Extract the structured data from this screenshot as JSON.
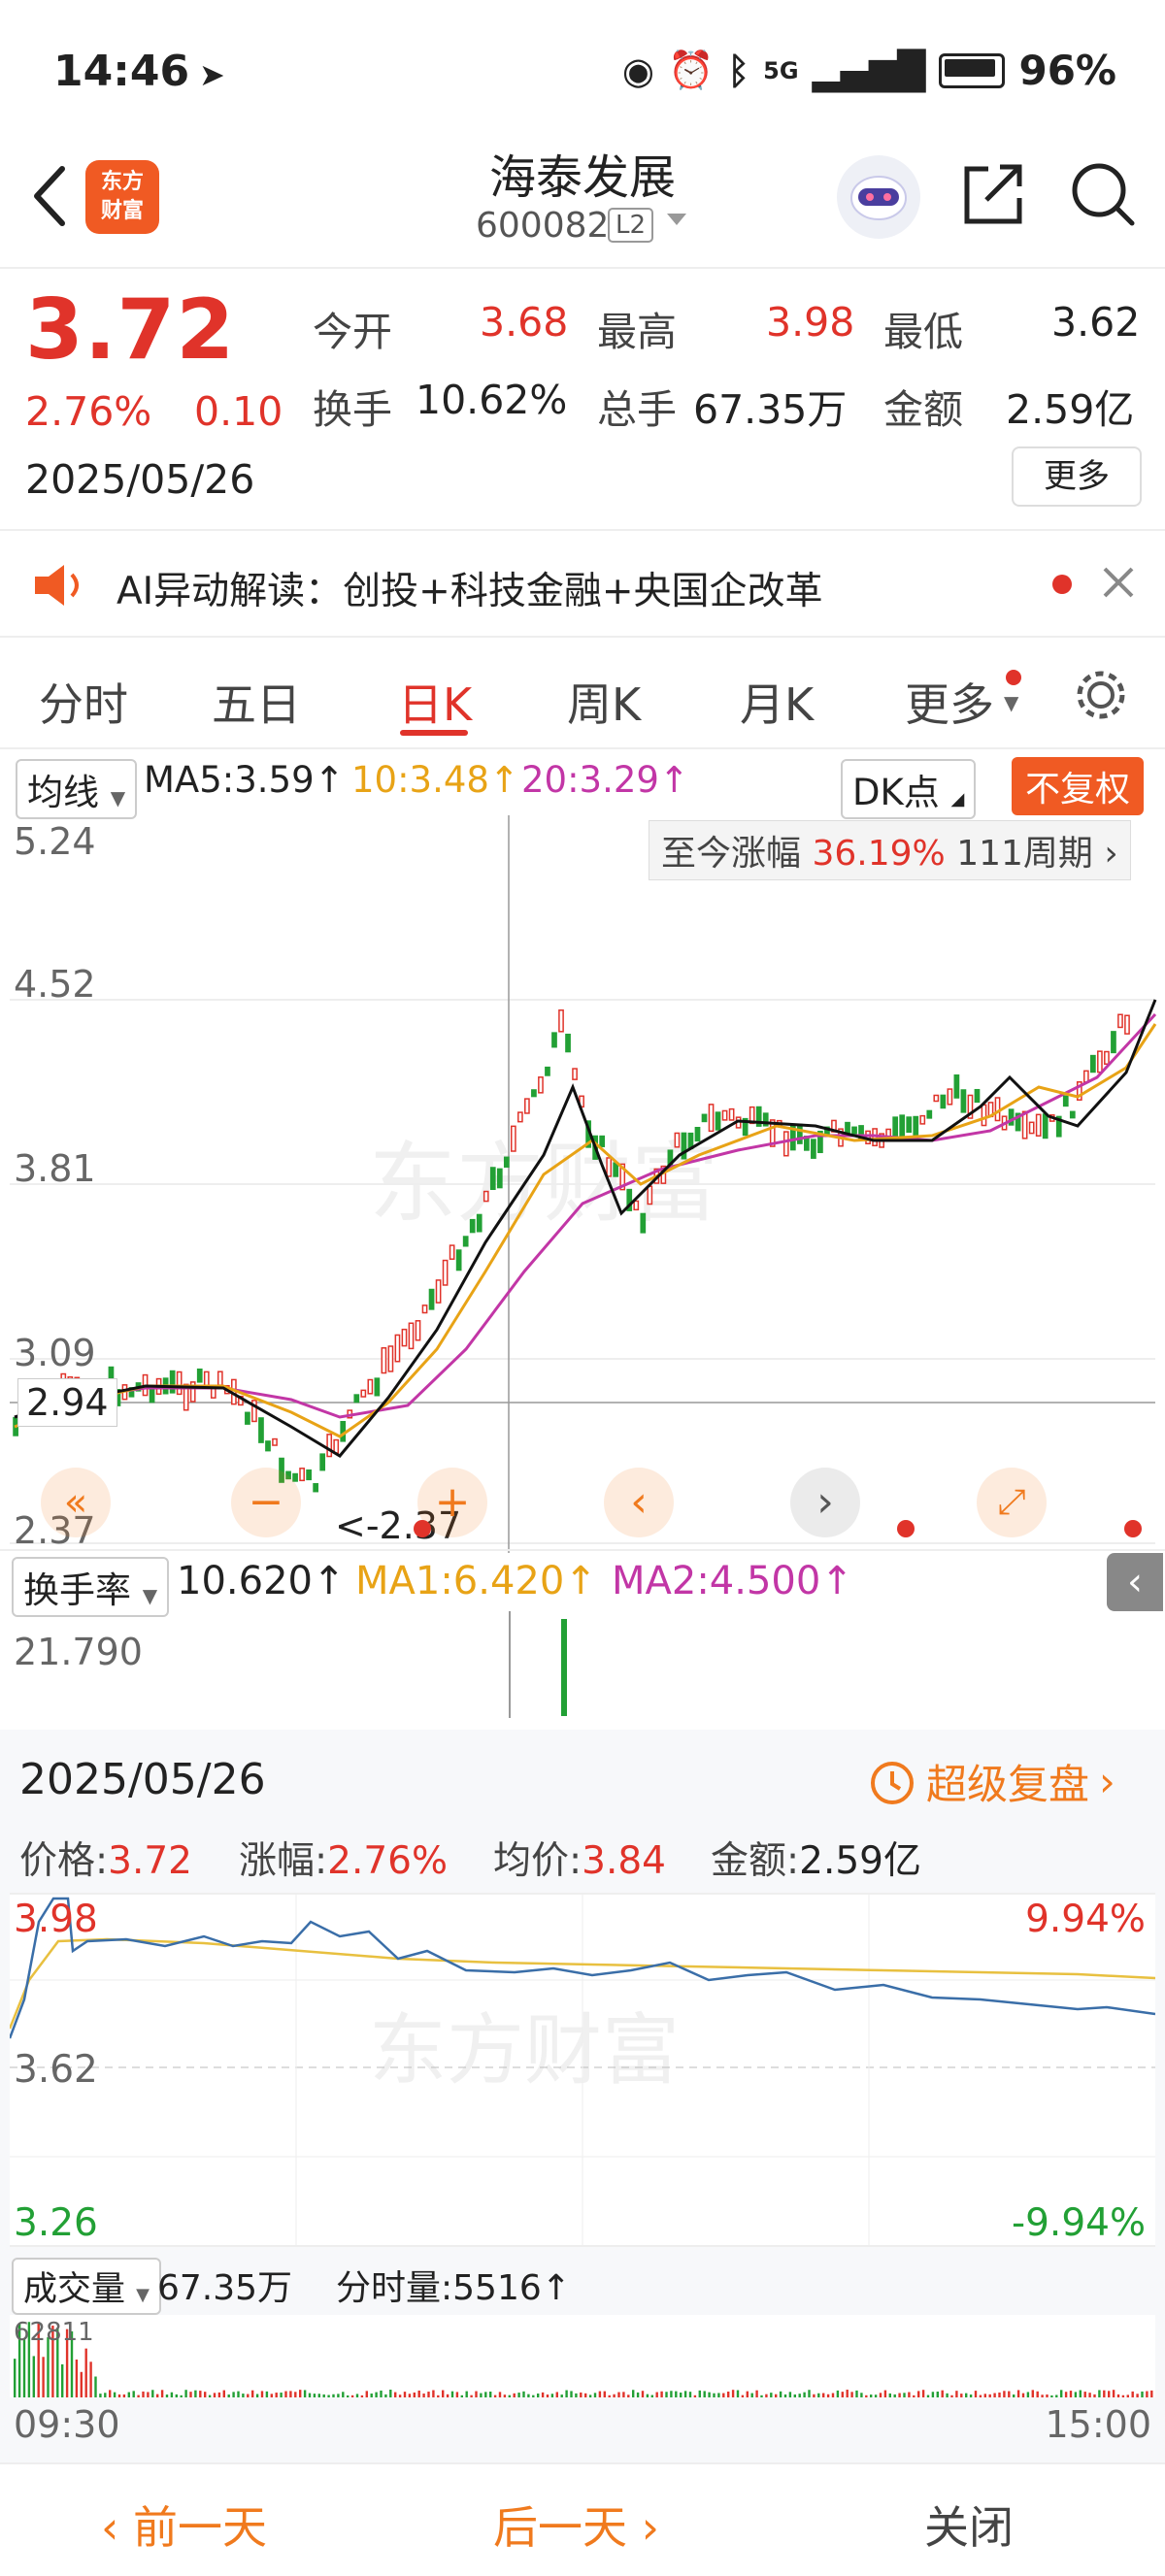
{
  "status": {
    "time": "14:46",
    "battery": "96%",
    "network": "5G"
  },
  "header": {
    "back_icon": "chevron-left-icon",
    "logo_line1": "东方",
    "logo_line2": "财富",
    "name": "海泰发展",
    "code": "600082",
    "level": "L2"
  },
  "quote": {
    "price": "3.72",
    "change_pct": "2.76%",
    "change": "0.10",
    "date": "2025/05/26",
    "open_label": "今开",
    "open": "3.68",
    "high_label": "最高",
    "high": "3.98",
    "low_label": "最低",
    "low": "3.62",
    "turnover_label": "换手",
    "turnover": "10.62%",
    "volume_label": "总手",
    "volume": "67.35万",
    "amount_label": "金额",
    "amount": "2.59亿",
    "more_label": "更多"
  },
  "ai_banner": {
    "text": "AI异动解读：创投+科技金融+央国企改革"
  },
  "tabs": [
    "分时",
    "五日",
    "日K",
    "周K",
    "月K",
    "更多"
  ],
  "active_tab": "日K",
  "indicators": {
    "ma_select": "均线",
    "ma5": "MA5:3.59↑",
    "ma10": "10:3.48↑",
    "ma20": "20:3.29↑",
    "dk_label": "DK点",
    "fuquan_label": "不复权",
    "since_label": "至今涨幅",
    "since_pct": "36.19%",
    "since_period": "111周期"
  },
  "kline": {
    "y_labels": [
      "5.24",
      "4.52",
      "3.81",
      "3.09",
      "2.37"
    ],
    "cursor_price": "2.94",
    "min_label": "<-2.37",
    "watermark": "东方财富"
  },
  "turnover_panel": {
    "select": "换手率",
    "value": "10.620↑",
    "ma1": "MA1:6.420↑",
    "ma2": "MA2:4.500↑",
    "y_max": "21.790"
  },
  "intraday": {
    "date": "2025/05/26",
    "replay_label": "超级复盘",
    "price_label": "价格:",
    "price": "3.72",
    "pct_label": "涨幅:",
    "pct": "2.76%",
    "avg_label": "均价:",
    "avg": "3.84",
    "amount_label": "金额:",
    "amount": "2.59亿",
    "y_high": "3.98",
    "y_mid": "3.62",
    "y_low": "3.26",
    "pct_high": "9.94%",
    "pct_low": "-9.94%",
    "vol_select": "成交量",
    "vol_total": "67.35万",
    "vol_now": "分时量:5516↑",
    "vol_max": "62811",
    "time_start": "09:30",
    "time_end": "15:00",
    "watermark": "东方财富"
  },
  "bottom": {
    "prev": "前一天",
    "next": "后一天",
    "close": "关闭"
  },
  "colors": {
    "up": "#e0332a",
    "down": "#22a035",
    "accent": "#f05a23",
    "ma10": "#e8a316",
    "ma20": "#c236a6",
    "price_line": "#3a6ea8"
  }
}
